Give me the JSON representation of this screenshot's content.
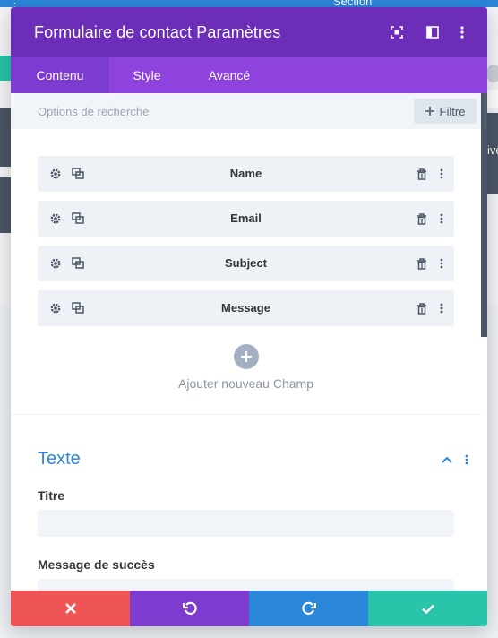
{
  "background": {
    "section_label": "Section",
    "right_text": "ive"
  },
  "modal": {
    "title": "Formulaire de contact Paramètres",
    "header_icons": [
      "fullscreen-icon",
      "split-view-icon",
      "more-options-icon"
    ],
    "tabs": [
      {
        "label": "Contenu",
        "active": true
      },
      {
        "label": "Style",
        "active": false
      },
      {
        "label": "Avancé",
        "active": false
      }
    ],
    "search": {
      "placeholder": "Options de recherche",
      "filter_label": "Filtre"
    },
    "fields": [
      {
        "label": "Name"
      },
      {
        "label": "Email"
      },
      {
        "label": "Subject"
      },
      {
        "label": "Message"
      }
    ],
    "add_field_label": "Ajouter nouveau Champ",
    "text_section": {
      "title": "Texte",
      "titre_label": "Titre",
      "titre_value": "",
      "success_label": "Message de succès",
      "success_value": ""
    },
    "footer": {
      "colors": {
        "cancel": "#ef5555",
        "undo": "#7e3bd0",
        "redo": "#2b87da",
        "save": "#29c4a9"
      }
    }
  },
  "colors": {
    "header": "#6c2eb9",
    "tabs": "#8e42de",
    "accent_blue": "#2b87da",
    "field_bg": "#eef2f7"
  }
}
